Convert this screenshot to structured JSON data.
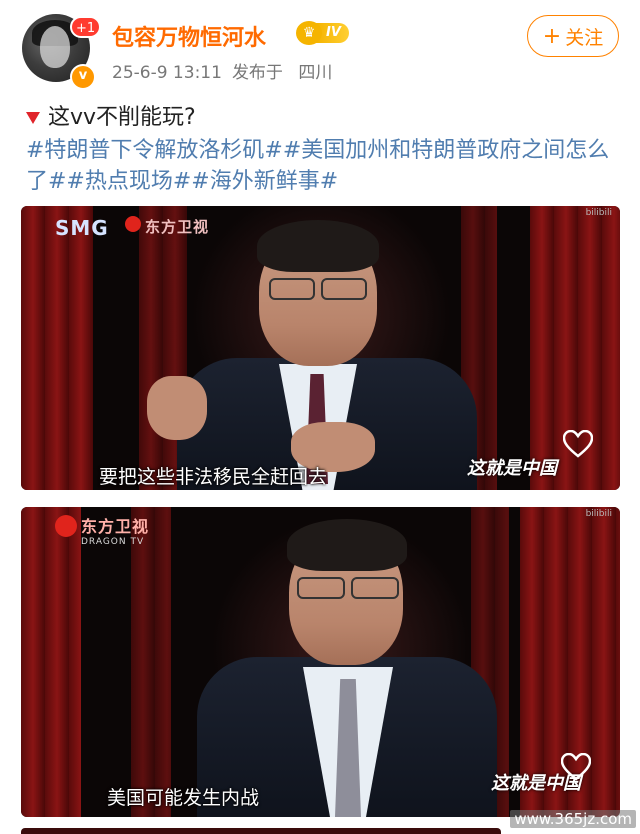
{
  "post": {
    "author": {
      "name": "包容万物恒河水",
      "avatar_badge_count": "+1",
      "verified_icon": "v-badge-icon",
      "vip_level": "IV"
    },
    "meta": {
      "timestamp": "25-6-9 13:11",
      "location_prefix": "发布于",
      "location": "四川"
    },
    "follow_label": "关注",
    "follow_plus": "+",
    "text": "这vv不削能玩?",
    "hashtags": "#特朗普下令解放洛杉矶##美国加州和特朗普政府之间怎么了##热点现场##海外新鲜事#"
  },
  "videos": [
    {
      "channel_logo": "SMG",
      "channel_name": "东方卫视",
      "subtitle": "要把这些非法移民全赶回去",
      "show_logo": "这就是中国",
      "corner_mark": "bilibili"
    },
    {
      "channel_name": "东方卫视",
      "channel_sub": "DRAGON TV",
      "subtitle": "美国可能发生内战",
      "show_logo": "这就是中国",
      "corner_mark": "bilibili"
    }
  ],
  "watermark": "www.365jz.com",
  "colors": {
    "name_orange": "#ff6a00",
    "follow_orange": "#ff8200",
    "hashtag_blue": "#507daf",
    "meta_gray": "#777777"
  }
}
